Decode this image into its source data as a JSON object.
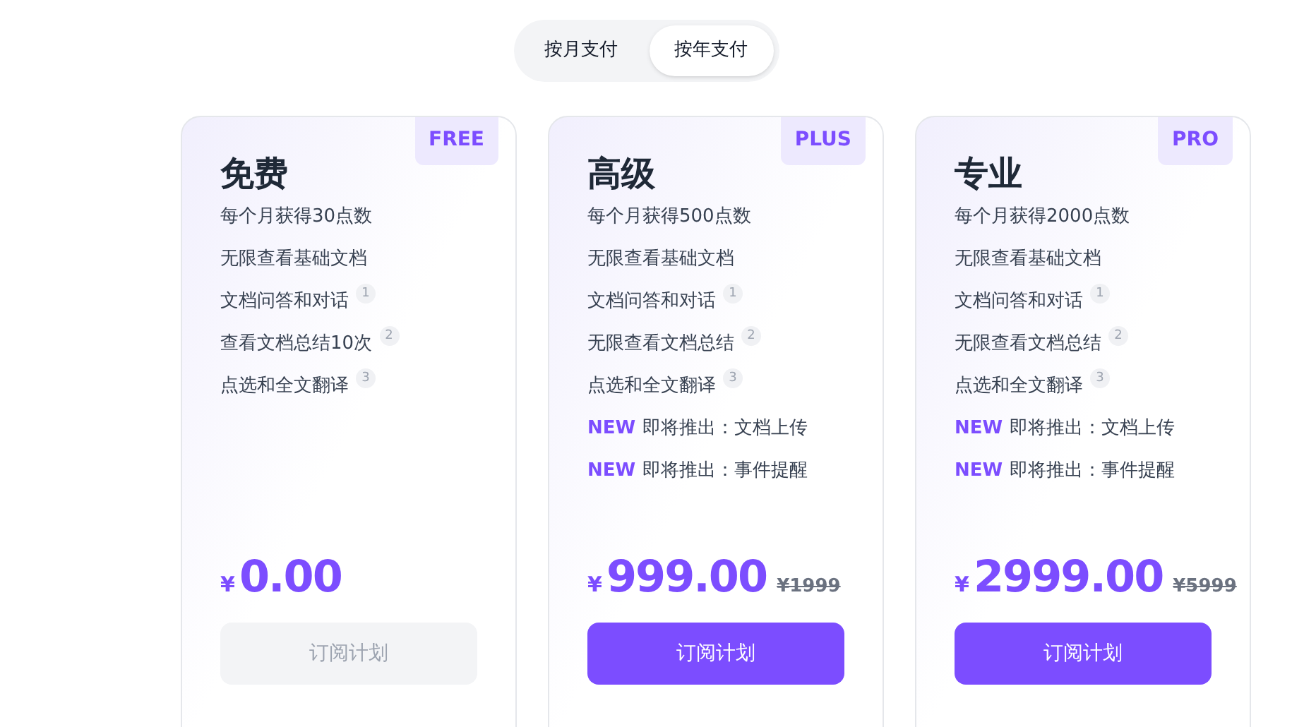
{
  "billing_toggle": [
    {
      "label": "按月支付",
      "selected": false
    },
    {
      "label": "按年支付",
      "selected": true
    }
  ],
  "plans": [
    {
      "badge": "FREE",
      "title": "免费",
      "features": [
        {
          "text": "每个月获得30点数"
        },
        {
          "text": "无限查看基础文档"
        },
        {
          "text": "文档问答和对话",
          "note": "1"
        },
        {
          "text": "查看文档总结10次",
          "note": "2"
        },
        {
          "text": "点选和全文翻译",
          "note": "3"
        }
      ],
      "currency": "¥",
      "price": "0.00",
      "button": {
        "label": "订阅计划",
        "disabled": true
      }
    },
    {
      "badge": "PLUS",
      "title": "高级",
      "features": [
        {
          "text": "每个月获得500点数"
        },
        {
          "text": "无限查看基础文档"
        },
        {
          "text": "文档问答和对话",
          "note": "1"
        },
        {
          "text": "无限查看文档总结",
          "note": "2"
        },
        {
          "text": "点选和全文翻译",
          "note": "3"
        },
        {
          "tag": "NEW",
          "text": "即将推出：文档上传"
        },
        {
          "tag": "NEW",
          "text": "即将推出：事件提醒"
        }
      ],
      "currency": "¥",
      "price": "999.00",
      "original_price": "¥1999",
      "button": {
        "label": "订阅计划",
        "disabled": false
      }
    },
    {
      "badge": "PRO",
      "title": "专业",
      "features": [
        {
          "text": "每个月获得2000点数"
        },
        {
          "text": "无限查看基础文档"
        },
        {
          "text": "文档问答和对话",
          "note": "1"
        },
        {
          "text": "无限查看文档总结",
          "note": "2"
        },
        {
          "text": "点选和全文翻译",
          "note": "3"
        },
        {
          "tag": "NEW",
          "text": "即将推出：文档上传"
        },
        {
          "tag": "NEW",
          "text": "即将推出：事件提醒"
        }
      ],
      "currency": "¥",
      "price": "2999.00",
      "original_price": "¥5999",
      "button": {
        "label": "订阅计划",
        "disabled": false
      }
    }
  ]
}
